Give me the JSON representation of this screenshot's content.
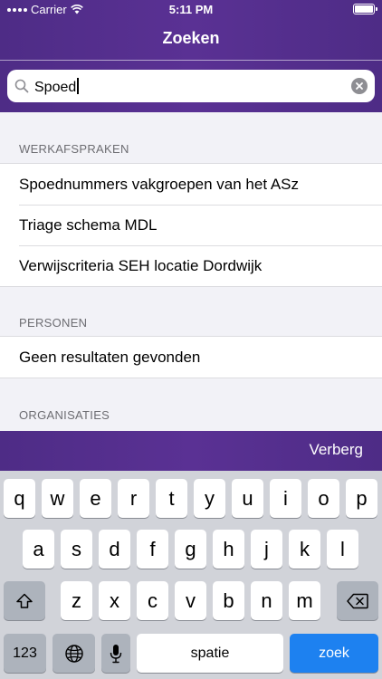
{
  "status_bar": {
    "carrier": "Carrier",
    "time": "5:11 PM",
    "icons": [
      "wifi-icon",
      "battery-icon"
    ]
  },
  "nav": {
    "title": "Zoeken"
  },
  "search": {
    "value": "Spoed",
    "icons": [
      "search-icon",
      "clear-icon"
    ]
  },
  "sections": [
    {
      "header": "WERKAFSPRAKEN",
      "items": [
        "Spoednummers vakgroepen van het ASz",
        "Triage schema MDL",
        "Verwijscriteria SEH locatie Dordwijk"
      ]
    },
    {
      "header": "PERSONEN",
      "items": [
        "Geen resultaten gevonden"
      ]
    },
    {
      "header": "ORGANISATIES",
      "items": []
    }
  ],
  "accessory": {
    "hide_label": "Verberg"
  },
  "keyboard": {
    "row1": [
      "q",
      "w",
      "e",
      "r",
      "t",
      "y",
      "u",
      "i",
      "o",
      "p"
    ],
    "row2": [
      "a",
      "s",
      "d",
      "f",
      "g",
      "h",
      "j",
      "k",
      "l"
    ],
    "row3": [
      "z",
      "x",
      "c",
      "v",
      "b",
      "n",
      "m"
    ],
    "numbers_label": "123",
    "space_label": "spatie",
    "return_label": "zoek",
    "icons": [
      "shift-icon",
      "backspace-icon",
      "globe-icon",
      "microphone-icon"
    ]
  },
  "colors": {
    "header_purple": "#5a3194",
    "return_key_blue": "#1d81f0"
  }
}
